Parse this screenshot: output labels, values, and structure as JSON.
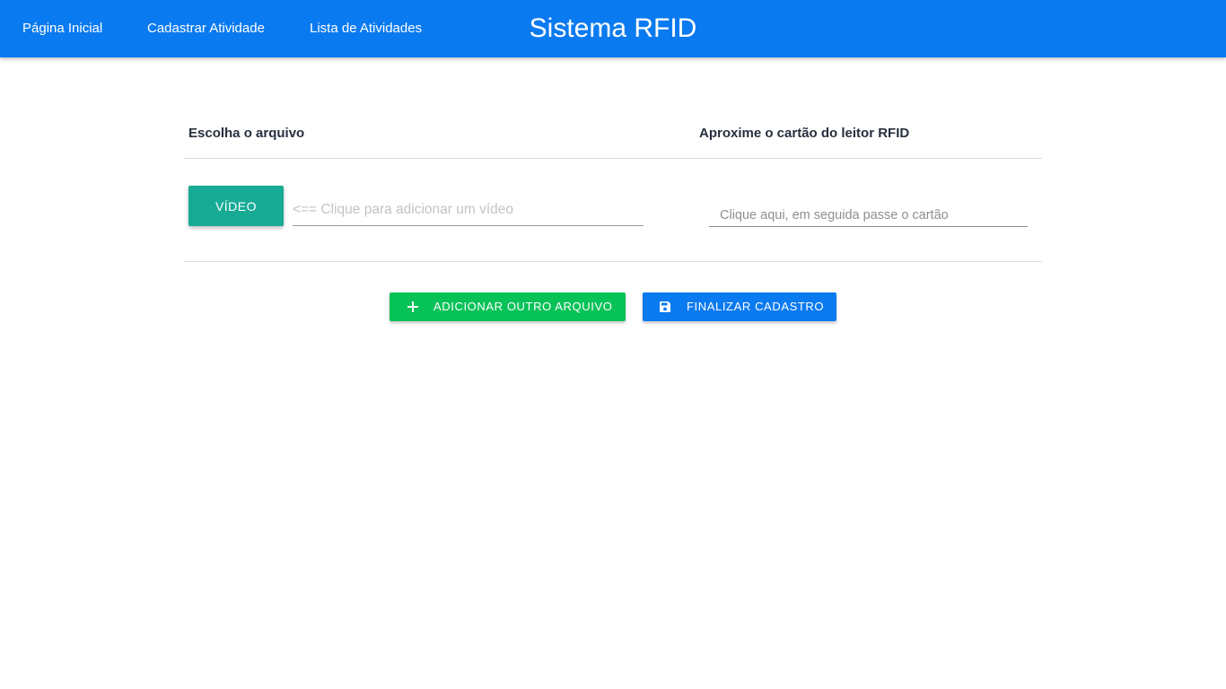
{
  "header": {
    "title": "Sistema RFID",
    "nav": [
      {
        "label": "Página Inicial"
      },
      {
        "label": "Cadastrar Atividade"
      },
      {
        "label": "Lista de Atividades"
      }
    ],
    "background_color": "#0a7af0"
  },
  "table": {
    "column_headers": [
      "Escolha o arquivo",
      "Aproxime o cartão do leitor RFID"
    ],
    "video_button_label": "VÍDEO",
    "file_placeholder": "<== Clique para adicionar um vídeo",
    "file_value": "",
    "card_placeholder": "Clique aqui, em seguida passe o cartão",
    "card_value": ""
  },
  "actions": {
    "add_label": "ADICIONAR OUTRO ARQUIVO",
    "add_icon": "plus-icon",
    "add_color": "#07c257",
    "finish_label": "FINALIZAR CADASTRO",
    "finish_icon": "save-icon",
    "finish_color": "#0a7af0"
  },
  "colors": {
    "video_button": "#17ab96"
  }
}
